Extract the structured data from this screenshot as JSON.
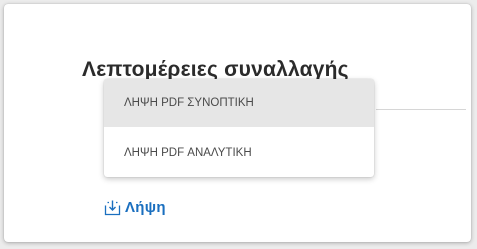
{
  "page": {
    "title": "Λεπτομέρειες συναλλαγής"
  },
  "download_menu": {
    "items": [
      {
        "label": "ΛΗΨΗ PDF ΣΥΝΟΠΤΙΚΗ",
        "highlighted": true
      },
      {
        "label": "ΛΗΨΗ PDF ΑΝΑΛΥΤΙΚΗ",
        "highlighted": false
      }
    ]
  },
  "download_link": {
    "label": "Λήψη",
    "icon": "download-icon"
  },
  "colors": {
    "accent": "#1a6fbf",
    "menu_highlight": "#e6e6e6",
    "text": "#4a4a4a"
  }
}
